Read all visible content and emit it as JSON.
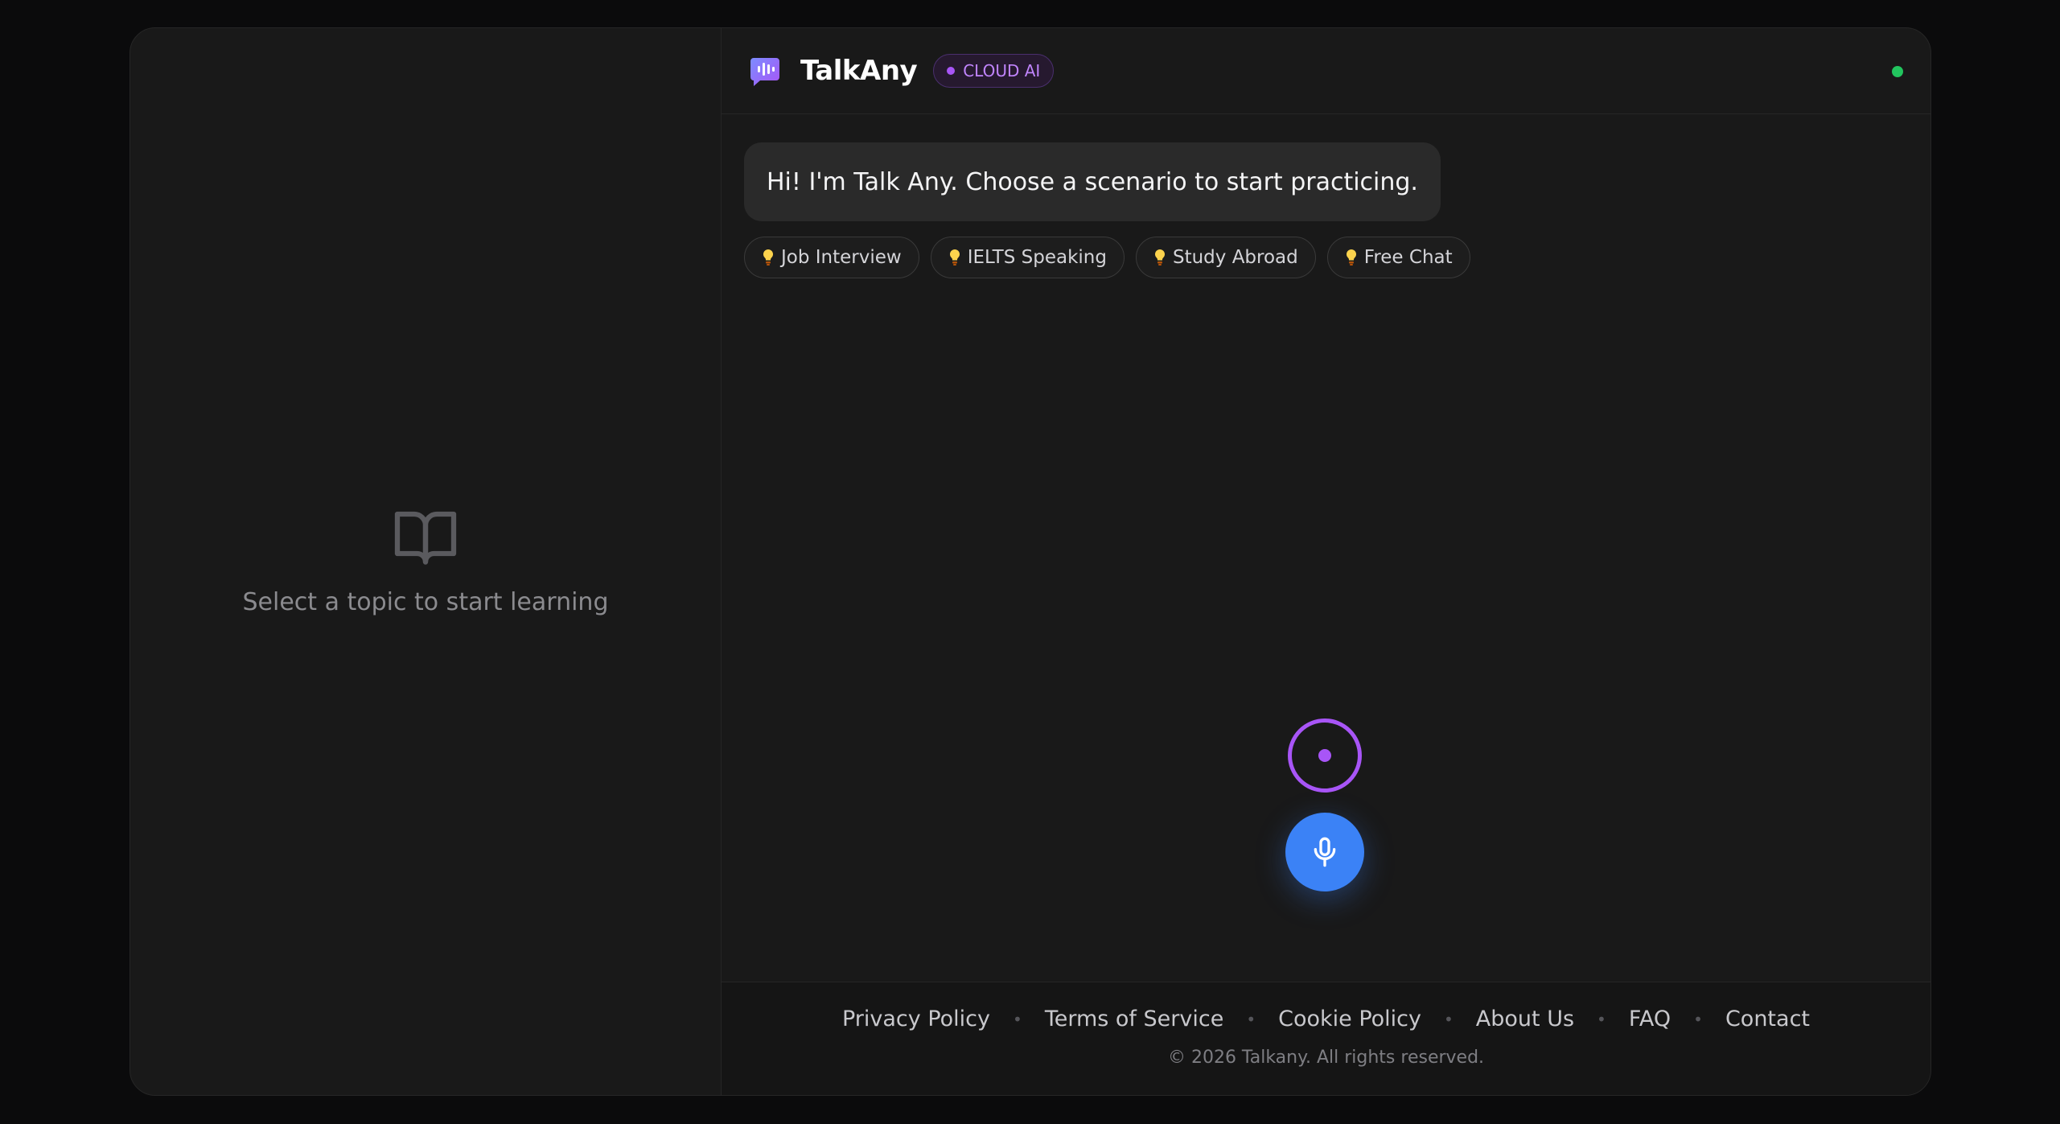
{
  "left_panel": {
    "empty_icon": "open-book-icon",
    "empty_text": "Select a topic to start learning"
  },
  "header": {
    "logo_icon": "chat-waveform-icon",
    "brand": "TalkAny",
    "badge": "CLOUD AI",
    "status_color": "#22c55e"
  },
  "chat": {
    "greeting": "Hi! I'm Talk Any. Choose a scenario to start practicing.",
    "scenarios": [
      {
        "label": "Job Interview",
        "icon": "lightbulb-icon"
      },
      {
        "label": "IELTS Speaking",
        "icon": "lightbulb-icon"
      },
      {
        "label": "Study Abroad",
        "icon": "lightbulb-icon"
      },
      {
        "label": "Free Chat",
        "icon": "lightbulb-icon"
      }
    ]
  },
  "controls": {
    "record_indicator_icon": "record-ring-icon",
    "mic_icon": "microphone-icon"
  },
  "footer": {
    "links": [
      "Privacy Policy",
      "Terms of Service",
      "Cookie Policy",
      "About Us",
      "FAQ",
      "Contact"
    ],
    "copyright": "© 2026 Talkany. All rights reserved."
  },
  "colors": {
    "accent_purple": "#a855f7",
    "mic_blue": "#3b82f6",
    "background": "#191919"
  }
}
